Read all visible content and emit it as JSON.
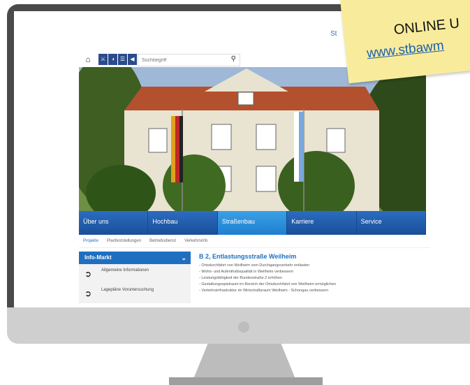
{
  "top_link": "St",
  "toolbar": {
    "home_icon": "home-icon",
    "buttons": [
      "⚔",
      "◑",
      "☰",
      "◀"
    ],
    "search_placeholder": "Suchbegriff",
    "search_icon": "search-icon"
  },
  "main_nav": [
    {
      "label": "Über uns",
      "active": false
    },
    {
      "label": "Hochbau",
      "active": false
    },
    {
      "label": "Straßenbau",
      "active": true
    },
    {
      "label": "Karriere",
      "active": false
    },
    {
      "label": "Service",
      "active": false
    }
  ],
  "sub_nav": [
    {
      "label": "Projekte",
      "active": true
    },
    {
      "label": "Planfeststellungen",
      "active": false
    },
    {
      "label": "Betriebsdienst",
      "active": false
    },
    {
      "label": "Verkehrsinfo",
      "active": false
    }
  ],
  "info_panel": {
    "title": "Info-Markt",
    "items": [
      "Allgemeine Informationen",
      "Lagepläne Voruntersuchung"
    ]
  },
  "content": {
    "title": "B 2, Entlastungsstraße Weilheim",
    "bullets": [
      "- Ortsdurchfahrt von Weilheim vom Durchgangsverkehr entlasten",
      "- Wohn- und Aufenthaltsqualität in Weilheim verbessern",
      "- Leistungsfähigkeit der Bundesstraße 2 erhöhen",
      "- Gestaltungsspielraum im Bereich der Ortsdurchfahrt von Weilheim ermöglichen",
      "- Verkehrsinfrastruktur im Wirtschaftsraum Weilheim - Schongau verbessern"
    ]
  },
  "sticky_note": {
    "line1": "ONLINE U",
    "line2": "www.stbawm"
  },
  "colors": {
    "nav_blue": "#1f5ca8",
    "nav_active": "#3aa0e6",
    "accent_blue": "#1f6fc0",
    "sticky": "#f8ec9c"
  }
}
